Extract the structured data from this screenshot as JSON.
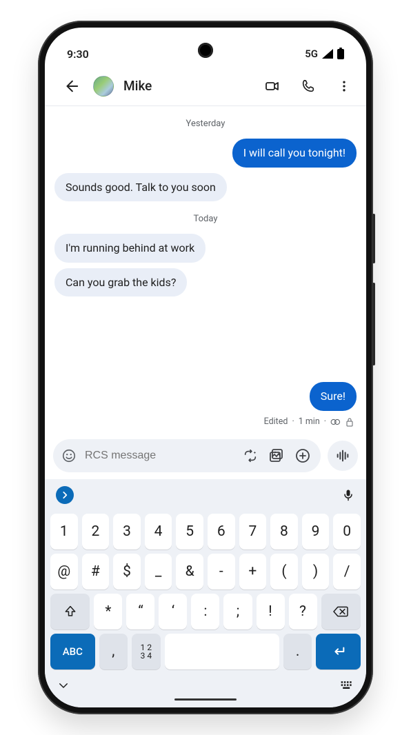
{
  "status": {
    "time": "9:30",
    "network": "5G"
  },
  "header": {
    "contact": "Mike"
  },
  "thread": {
    "sep1": "Yesterday",
    "out1": "I will call you tonight!",
    "in1": "Sounds good. Talk to you soon",
    "sep2": "Today",
    "in2": "I'm running behind at work",
    "in3": "Can you grab the kids?",
    "out2": "Sure!",
    "out2_meta_edited": "Edited",
    "out2_meta_time": "1 min"
  },
  "compose": {
    "placeholder": "RCS message"
  },
  "keyboard": {
    "row1": [
      "1",
      "2",
      "3",
      "4",
      "5",
      "6",
      "7",
      "8",
      "9",
      "0"
    ],
    "row2": [
      "@",
      "#",
      "$",
      "_",
      "&",
      "-",
      "+",
      "(",
      ")",
      "/"
    ],
    "row3": [
      "*",
      "“",
      "‘",
      ":",
      ";",
      "!",
      "?"
    ],
    "abc_label": "ABC",
    "numpad_label_top": "1 2",
    "numpad_label_bot": "3 4",
    "comma": ",",
    "period": "."
  }
}
